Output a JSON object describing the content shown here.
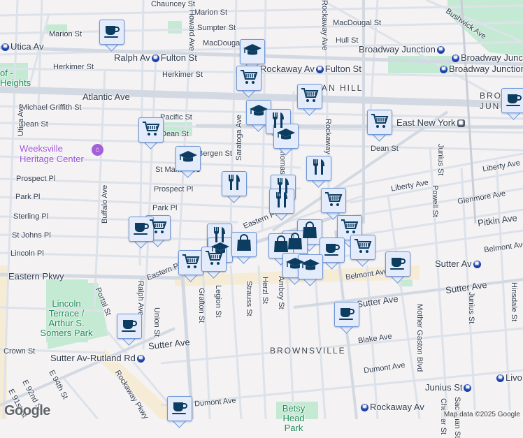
{
  "streets": [
    "Chauncey St",
    "Marion St",
    "Sumpter St",
    "MacDougal St",
    "Marion St",
    "Hull St",
    "MacDougal St",
    "Herkimer St",
    "Herkimer St",
    "Atlantic Ave",
    "Michael Griffith St",
    "Pacific St",
    "Dean St",
    "Dean St",
    "Bergen St",
    "St Marks Ave",
    "Prospect Pl",
    "Prospect Pl",
    "Park Pl",
    "Park Pl",
    "Sterling Pl",
    "St Johns Pl",
    "Lincoln Pl",
    "Eastern Pkwy",
    "Eastern Pkwy",
    "Utica Ave",
    "Howard Ave",
    "Saratoga Ave",
    "Rockaway Ave",
    "Buffalo Ave",
    "Ralph Ave",
    "Portal St",
    "Union St",
    "Grafton St",
    "Legion St",
    "Strauss St",
    "Herzl St",
    "Amboy St",
    "Thomas S",
    "Rockaway Ave",
    "Dean St",
    "Liberty Ave",
    "Liberty Ave",
    "Glenmore Ave",
    "Pitkin Ave",
    "Belmont Ave",
    "Belmont Ave",
    "Sutter Ave",
    "Sutter Ave",
    "Sutter Ave",
    "Blake Ave",
    "Dumont Ave",
    "Dumont Ave",
    "Crown St",
    "Rockaway Pkwy",
    "E 94th St",
    "E 92nd St",
    "E 91st St",
    "Junius St",
    "Junius St",
    "Powell St",
    "Mother Gaston Blvd",
    "Hinsdale St",
    "Bushwick Ave",
    "Sackman St",
    "Chester St",
    "Eastern Pkwy",
    "Fulton St",
    "Belmont Ave"
  ],
  "stations": {
    "utica": "Utica Av",
    "ralph": "Ralph Av",
    "fulton": "Fulton St",
    "rockaway_fulton": "Rockaway Av",
    "bj1": "Broadway Junction",
    "bj2": "Broadway Junction",
    "bj3": "Broadway Junction",
    "eny": "East New York",
    "sutter_rutland": "Sutter Av-Rutland Rd",
    "sutter": "Sutter Av",
    "junius": "Junius St",
    "rockaway": "Rockaway Av",
    "livonia": "Livo"
  },
  "places": {
    "weeksville": "Weeksville Heritage Center",
    "lincoln_terrace": "Lincoln Terrace / Arthur S. Somers Park",
    "betsy": "Betsy Head Park",
    "heights": "of - Heights",
    "brownsville": "BROWNSVILLE",
    "ocean_hill": "AN HILL",
    "broadway_jct": "BROA JUN"
  },
  "markers": [
    {
      "type": "coffee"
    },
    {
      "type": "grad"
    },
    {
      "type": "cart"
    },
    {
      "type": "cart"
    },
    {
      "type": "grad"
    },
    {
      "type": "fork"
    },
    {
      "type": "grad"
    },
    {
      "type": "cart"
    },
    {
      "type": "cart"
    },
    {
      "type": "grad"
    },
    {
      "type": "fork"
    },
    {
      "type": "fork"
    },
    {
      "type": "fork"
    },
    {
      "type": "fork"
    },
    {
      "type": "cart"
    },
    {
      "type": "coffee"
    },
    {
      "type": "cart"
    },
    {
      "type": "coffee"
    },
    {
      "type": "fork"
    },
    {
      "type": "grad"
    },
    {
      "type": "bag"
    },
    {
      "type": "bag"
    },
    {
      "type": "bag"
    },
    {
      "type": "bag"
    },
    {
      "type": "cart"
    },
    {
      "type": "cart"
    },
    {
      "type": "cart"
    },
    {
      "type": "cart"
    },
    {
      "type": "coffee"
    },
    {
      "type": "grad"
    },
    {
      "type": "grad"
    },
    {
      "type": "coffee"
    },
    {
      "type": "coffee"
    },
    {
      "type": "coffee"
    },
    {
      "type": "coffee"
    }
  ],
  "colors": {
    "icon": "#0d3c61",
    "marker_bg": "#e4ecfb",
    "marker_border": "#6f97d8",
    "park": "#bfe8cf",
    "road": "#dde2ea"
  },
  "logo": "Google",
  "attribution": "Map data ©2025 Google"
}
